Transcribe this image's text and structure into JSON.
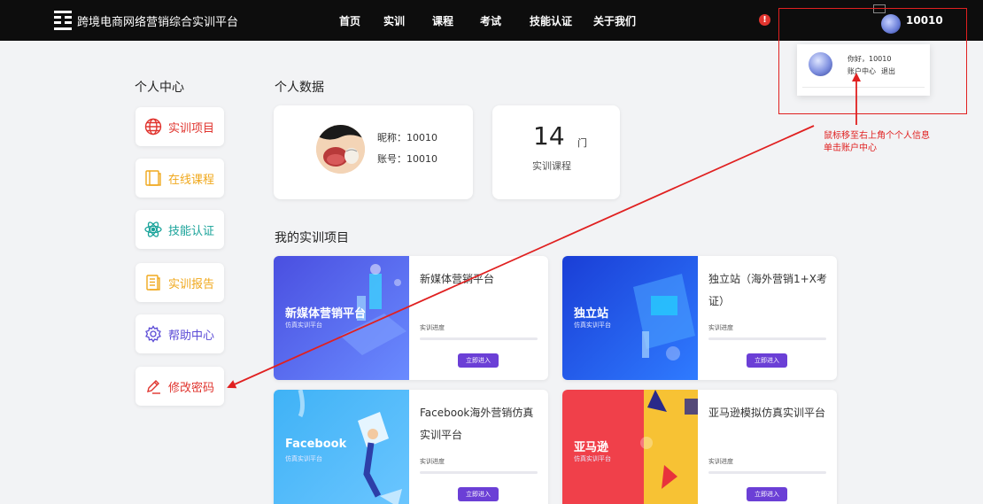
{
  "header": {
    "brand": "跨境电商网络营销综合实训平台",
    "nav": [
      "首页",
      "实训",
      "课程",
      "考试",
      "技能认证",
      "关于我们"
    ],
    "alert_glyph": "!",
    "user_id": "10010"
  },
  "dropdown": {
    "greeting": "你好，10010",
    "account_center": "账户中心",
    "logout": "退出"
  },
  "annotation": {
    "line1": "鼠标移至右上角个个人信息",
    "line2": "单击账户中心"
  },
  "sidebar": {
    "title": "个人中心",
    "items": [
      {
        "label": "实训项目",
        "icon": "globe-icon",
        "color": "#e0342e"
      },
      {
        "label": "在线课程",
        "icon": "book-icon",
        "color": "#f0a81c"
      },
      {
        "label": "技能认证",
        "icon": "atom-icon",
        "color": "#1aa39a"
      },
      {
        "label": "实训报告",
        "icon": "report-icon",
        "color": "#f0a81c"
      },
      {
        "label": "帮助中心",
        "icon": "gear-icon",
        "color": "#5b4bd6"
      },
      {
        "label": "修改密码",
        "icon": "pencil-icon",
        "color": "#e0342e"
      }
    ]
  },
  "personal": {
    "title": "个人数据",
    "nickname": "昵称：10010",
    "account": "账号：10010",
    "count": "14",
    "count_unit": "门",
    "count_label": "实训课程"
  },
  "projects": {
    "title": "我的实训项目",
    "progress_label": "实训进度",
    "enter_label": "立即进入",
    "items": [
      {
        "name": "新媒体营销平台",
        "thumb_title": "新媒体营销平台",
        "thumb_sub": "仿真实训平台",
        "progress": 0
      },
      {
        "name": "独立站（海外营销1+X考证）",
        "thumb_title": "独立站",
        "thumb_sub": "仿真实训平台",
        "progress": 0
      },
      {
        "name": "Facebook海外营销仿真实训平台",
        "thumb_title": "Facebook",
        "thumb_sub": "仿真实训平台",
        "progress": 0
      },
      {
        "name": "亚马逊模拟仿真实训平台",
        "thumb_title": "亚马逊",
        "thumb_sub": "仿真实训平台",
        "progress": 0
      }
    ]
  },
  "colors": {
    "topbar": "#0d0d0d",
    "accent_purple": "#6b3fd6",
    "annotation_red": "#e02020"
  }
}
